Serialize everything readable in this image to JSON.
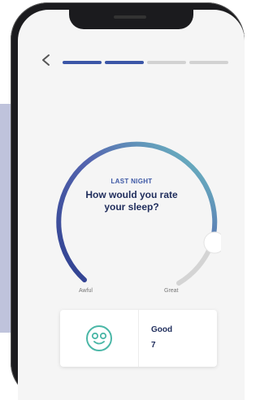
{
  "header": {
    "back_icon": "chevron-left-icon",
    "progress_total": 4,
    "progress_completed": 2
  },
  "question": {
    "eyebrow": "LAST NIGHT",
    "title": "How would you rate your sleep?"
  },
  "slider": {
    "min_label": "Awful",
    "max_label": "Great",
    "level": 1.0,
    "gradient": [
      "#2e3f8f",
      "#6fc9c4"
    ]
  },
  "result": {
    "icon": "smiley-face-icon",
    "label": "Good",
    "value": "7"
  },
  "colors": {
    "accent": "#3b56a7",
    "teal": "#5fbfbf",
    "track": "#d4d4d4"
  }
}
